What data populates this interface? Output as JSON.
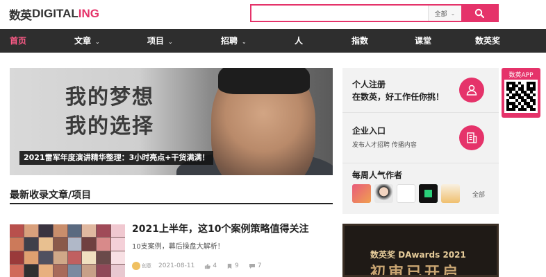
{
  "header": {
    "logo_cn": "数英",
    "logo_en_part1": "DIGITAL",
    "logo_en_part2": "ING",
    "search_placeholder": "",
    "search_scope": "全部",
    "brand_color": "#e5336a"
  },
  "nav": {
    "items": [
      {
        "label": "首页",
        "active": true,
        "dropdown": false
      },
      {
        "label": "文章",
        "active": false,
        "dropdown": true
      },
      {
        "label": "项目",
        "active": false,
        "dropdown": true
      },
      {
        "label": "招聘",
        "active": false,
        "dropdown": true
      },
      {
        "label": "人",
        "active": false,
        "dropdown": false
      },
      {
        "label": "指数",
        "active": false,
        "dropdown": false
      },
      {
        "label": "课堂",
        "active": false,
        "dropdown": false
      },
      {
        "label": "数英奖",
        "active": false,
        "dropdown": false
      }
    ]
  },
  "hero": {
    "headline_line1": "我的梦想",
    "headline_line2": "我的选择",
    "caption": "2021雷军年度演讲精华整理：3小时亮点+干货满满！"
  },
  "section": {
    "title": "最新收录文章/项目"
  },
  "article": {
    "title": "2021上半年，这10个案例策略值得关注",
    "description": "10支案例，幕后操盘大解析！",
    "author": "创意",
    "date": "2021-08-11",
    "likes": "4",
    "favorites": "9",
    "comments": "7"
  },
  "sidebar": {
    "register_title": "个人注册",
    "register_subtitle": "在数英，好工作任你挑！",
    "enterprise_title": "企业入口",
    "enterprise_links": "发布人才招聘    传播内容",
    "popular_authors_title": "每周人气作者",
    "all_link": "全部"
  },
  "awards": {
    "title": "数英奖 DAwards 2021",
    "big_text": "初审已开启"
  },
  "app_badge": {
    "label": "数英APP"
  },
  "icons": {
    "search": "search-icon",
    "user": "user-icon",
    "building": "building-icon",
    "like": "like-icon",
    "favorite": "favorite-icon",
    "comment": "comment-icon"
  }
}
